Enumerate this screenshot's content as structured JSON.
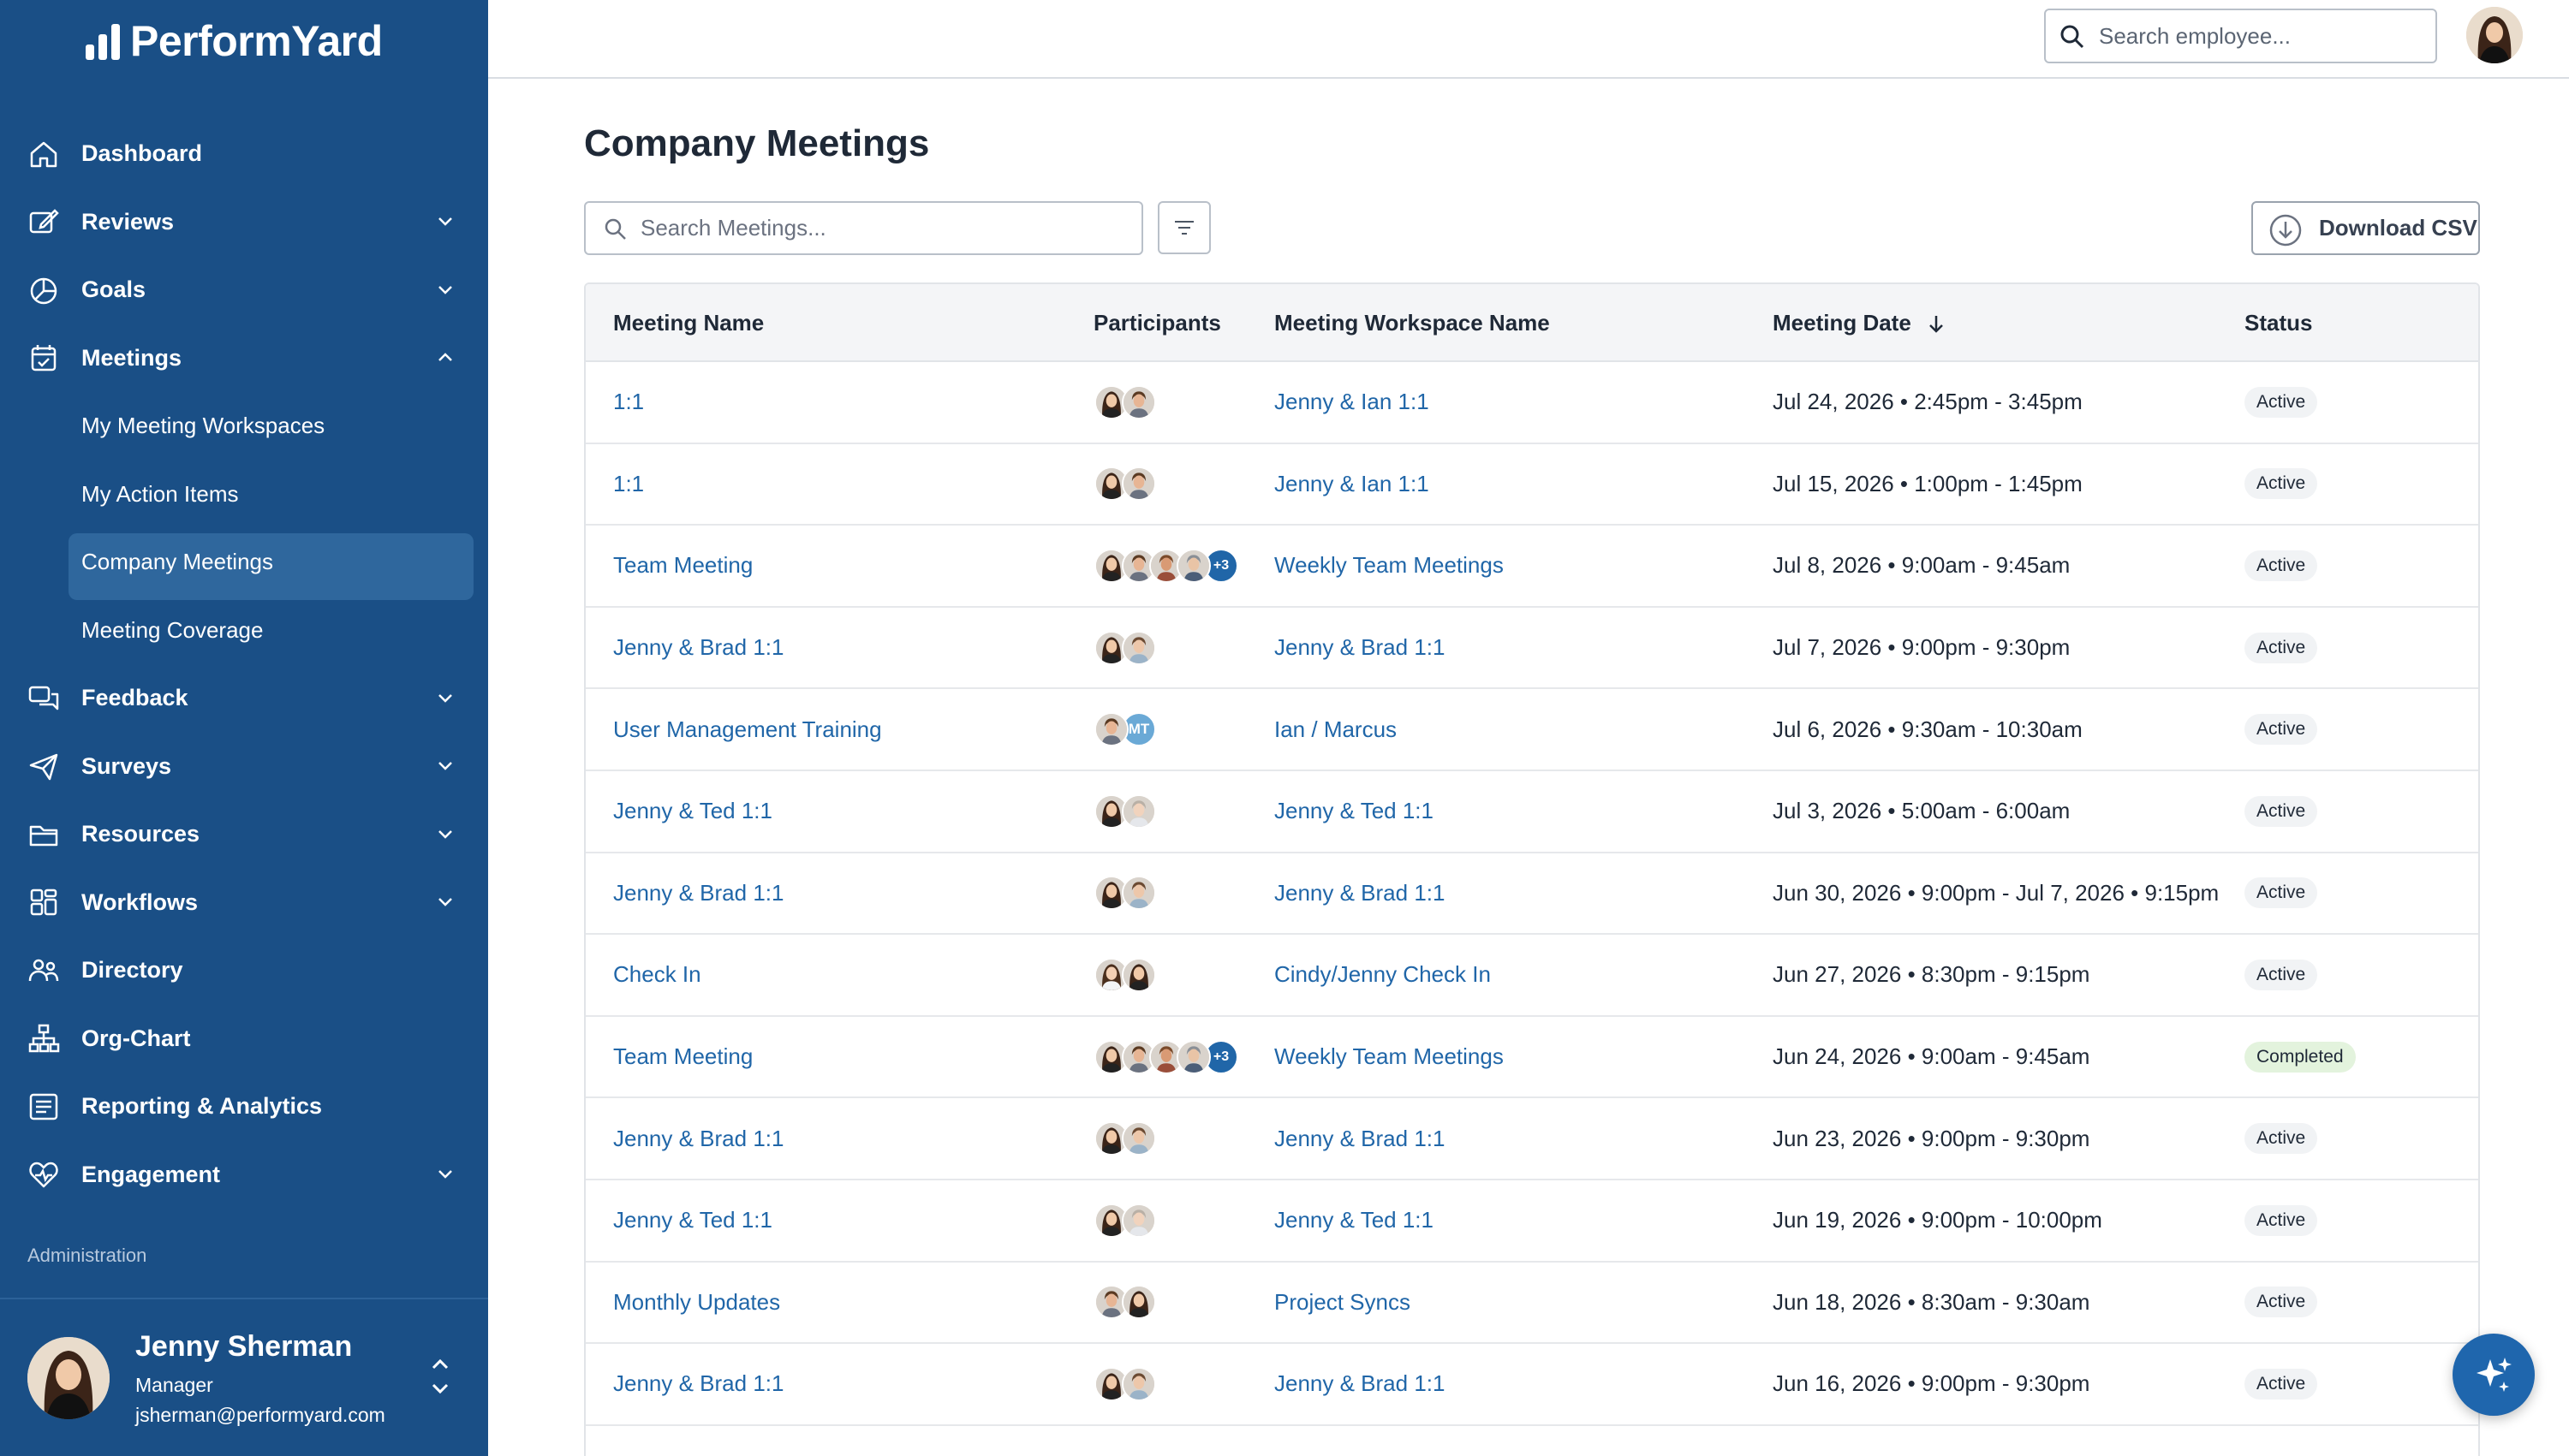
{
  "app": {
    "name": "PerformYard"
  },
  "sidebar": {
    "items": [
      {
        "label": "Dashboard",
        "icon": "home-icon",
        "expandable": false
      },
      {
        "label": "Reviews",
        "icon": "edit-icon",
        "expandable": true
      },
      {
        "label": "Goals",
        "icon": "pie-icon",
        "expandable": true
      },
      {
        "label": "Meetings",
        "icon": "calendar-icon",
        "expandable": true,
        "expanded": true,
        "children": [
          {
            "label": "My Meeting Workspaces"
          },
          {
            "label": "My Action Items"
          },
          {
            "label": "Company Meetings",
            "active": true
          },
          {
            "label": "Meeting Coverage"
          }
        ]
      },
      {
        "label": "Feedback",
        "icon": "chat-icon",
        "expandable": true
      },
      {
        "label": "Surveys",
        "icon": "send-icon",
        "expandable": true
      },
      {
        "label": "Resources",
        "icon": "folder-icon",
        "expandable": true
      },
      {
        "label": "Workflows",
        "icon": "grid-icon",
        "expandable": true
      },
      {
        "label": "Directory",
        "icon": "people-icon",
        "expandable": false
      },
      {
        "label": "Org-Chart",
        "icon": "org-chart-icon",
        "expandable": false
      },
      {
        "label": "Reporting & Analytics",
        "icon": "report-icon",
        "expandable": false
      },
      {
        "label": "Engagement",
        "icon": "heart-icon",
        "expandable": true
      }
    ],
    "section_label": "Administration",
    "user": {
      "name": "Jenny Sherman",
      "role": "Manager",
      "email": "jsherman@performyard.com"
    }
  },
  "topbar": {
    "search_placeholder": "Search employee..."
  },
  "main": {
    "title": "Company Meetings",
    "search_placeholder": "Search Meetings...",
    "download_label": "Download CSV",
    "columns": [
      "Meeting Name",
      "Participants",
      "Meeting Workspace Name",
      "Meeting Date",
      "Status"
    ],
    "rows": [
      {
        "name": "1:1",
        "participants": [
          "a",
          "b"
        ],
        "workspace": "Jenny & Ian 1:1",
        "date": "Jul 24, 2026 • 2:45pm - 3:45pm",
        "status": "Active"
      },
      {
        "name": "1:1",
        "participants": [
          "a",
          "b"
        ],
        "workspace": "Jenny & Ian 1:1",
        "date": "Jul 15, 2026 • 1:00pm - 1:45pm",
        "status": "Active"
      },
      {
        "name": "Team Meeting",
        "participants": [
          "a",
          "b",
          "c",
          "d"
        ],
        "more": "+3",
        "workspace": "Weekly Team Meetings",
        "date": "Jul 8, 2026 • 9:00am - 9:45am",
        "status": "Active"
      },
      {
        "name": "Jenny & Brad 1:1",
        "participants": [
          "a",
          "e"
        ],
        "workspace": "Jenny & Brad 1:1",
        "date": "Jul 7, 2026 • 9:00pm - 9:30pm",
        "status": "Active"
      },
      {
        "name": "User Management Training",
        "participants": [
          "b"
        ],
        "initials": "MT",
        "workspace": "Ian / Marcus",
        "date": "Jul 6, 2026 • 9:30am - 10:30am",
        "status": "Active"
      },
      {
        "name": "Jenny & Ted 1:1",
        "participants": [
          "a",
          "f"
        ],
        "workspace": "Jenny & Ted 1:1",
        "date": "Jul 3, 2026 • 5:00am - 6:00am",
        "status": "Active"
      },
      {
        "name": "Jenny & Brad 1:1",
        "participants": [
          "a",
          "e"
        ],
        "workspace": "Jenny & Brad 1:1",
        "date": "Jun 30, 2026 • 9:00pm - Jul 7, 2026 • 9:15pm",
        "status": "Active"
      },
      {
        "name": "Check In",
        "participants": [
          "g",
          "a"
        ],
        "workspace": "Cindy/Jenny Check In",
        "date": "Jun 27, 2026 • 8:30pm - 9:15pm",
        "status": "Active"
      },
      {
        "name": "Team Meeting",
        "participants": [
          "a",
          "b",
          "c",
          "d"
        ],
        "more": "+3",
        "workspace": "Weekly Team Meetings",
        "date": "Jun 24, 2026 • 9:00am - 9:45am",
        "status": "Completed"
      },
      {
        "name": "Jenny & Brad 1:1",
        "participants": [
          "a",
          "e"
        ],
        "workspace": "Jenny & Brad 1:1",
        "date": "Jun 23, 2026 • 9:00pm - 9:30pm",
        "status": "Active"
      },
      {
        "name": "Jenny & Ted 1:1",
        "participants": [
          "a",
          "f"
        ],
        "workspace": "Jenny & Ted 1:1",
        "date": "Jun 19, 2026 • 9:00pm - 10:00pm",
        "status": "Active"
      },
      {
        "name": "Monthly Updates",
        "participants": [
          "b",
          "a"
        ],
        "workspace": "Project Syncs",
        "date": "Jun 18, 2026 • 8:30am - 9:30am",
        "status": "Active"
      },
      {
        "name": "Jenny & Brad 1:1",
        "participants": [
          "a",
          "e"
        ],
        "workspace": "Jenny & Brad 1:1",
        "date": "Jun 16, 2026 • 9:00pm - 9:30pm",
        "status": "Active"
      }
    ]
  },
  "colors": {
    "sidebar_bg": "#1a4f86",
    "sidebar_active": "#2f679d",
    "link": "#2066a8",
    "fab": "#1f66ad",
    "completed_badge": "#e3f3dd"
  }
}
